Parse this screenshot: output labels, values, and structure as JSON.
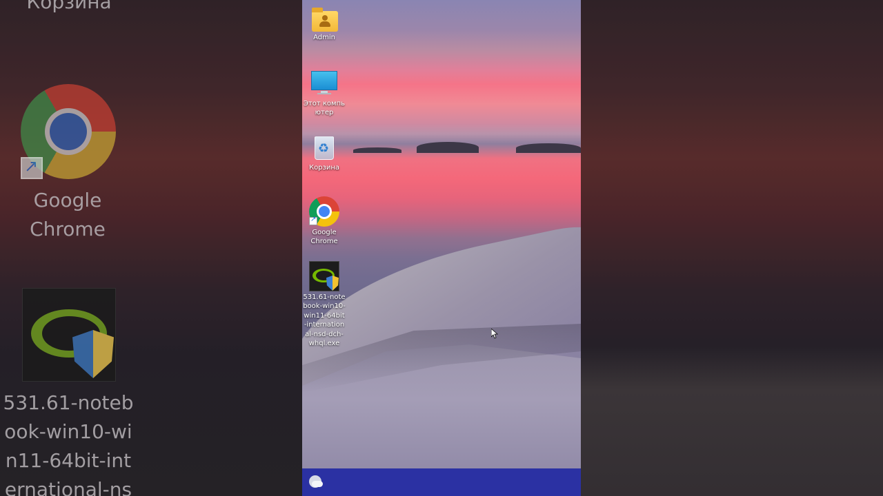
{
  "background_blur": {
    "top_label": "Корзина",
    "chrome_label": "Google Chrome",
    "nvidia_label_lines": [
      "531.61-noteb",
      "ook-win10-wi",
      "n11-64bit-int",
      "ernational-ns"
    ]
  },
  "desktop_icons": [
    {
      "label": "Admin",
      "icon": "user-folder-icon"
    },
    {
      "label": "Этот компьютер",
      "icon": "computer-monitor-icon"
    },
    {
      "label": "Корзина",
      "icon": "recycle-bin-icon"
    },
    {
      "label": "Google Chrome",
      "icon": "chrome-icon"
    },
    {
      "label": "531.61-notebook-win10-win11-64bit-international-nsd-dch-whql.exe",
      "icon": "nvidia-installer-icon"
    }
  ],
  "taskbar": {
    "color": "#2b31a3",
    "weather_icon": "weather-icon"
  },
  "colors": {
    "taskbar": "#2b31a3",
    "label_text": "#ffffff"
  }
}
